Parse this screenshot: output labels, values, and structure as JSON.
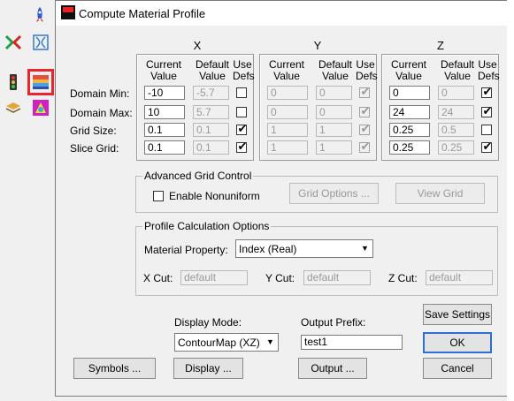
{
  "dialog": {
    "title": "Compute Material Profile",
    "axes": [
      "X",
      "Y",
      "Z"
    ],
    "col_headers": {
      "current": "Current Value",
      "default": "Default Value",
      "use": "Use Defs"
    },
    "rows": [
      "Domain Min:",
      "Domain Max:",
      "Grid Size:",
      "Slice Grid:"
    ],
    "x": {
      "current": [
        "-10",
        "10",
        "0.1",
        "0.1"
      ],
      "default": [
        "-5.7",
        "5.7",
        "0.1",
        "0.1"
      ],
      "use": [
        false,
        false,
        true,
        true
      ]
    },
    "y": {
      "current": [
        "0",
        "0",
        "1",
        "1"
      ],
      "default": [
        "0",
        "0",
        "1",
        "1"
      ],
      "use": [
        true,
        true,
        true,
        true
      ]
    },
    "z": {
      "current": [
        "0",
        "24",
        "0.25",
        "0.25"
      ],
      "default": [
        "0",
        "24",
        "0.5",
        "0.25"
      ],
      "use": [
        true,
        true,
        false,
        true
      ]
    },
    "advanced": {
      "legend": "Advanced Grid Control",
      "nonuniform_label": "Enable Nonuniform",
      "grid_options_label": "Grid Options ...",
      "view_grid_label": "View Grid"
    },
    "profile": {
      "legend": "Profile Calculation Options",
      "material_property_label": "Material Property:",
      "material_property_value": "Index (Real)",
      "x_cut_label": "X Cut:",
      "y_cut_label": "Y Cut:",
      "z_cut_label": "Z Cut:",
      "cut_placeholder": "default"
    },
    "display_mode_label": "Display Mode:",
    "display_mode_value": "ContourMap (XZ)",
    "output_prefix_label": "Output Prefix:",
    "output_prefix_value": "test1",
    "buttons": {
      "save_settings": "Save Settings",
      "ok": "OK",
      "cancel": "Cancel",
      "symbols": "Symbols ...",
      "display": "Display ...",
      "output": "Output ..."
    }
  },
  "toolbar": {
    "icons": [
      "rocket-icon",
      "merge-arrows-icon",
      "fiber-structure-icon",
      "traffic-light-icon",
      "material-profile-icon",
      "layer-stack-icon",
      "mode-solver-icon"
    ],
    "selected": "material-profile-icon"
  }
}
